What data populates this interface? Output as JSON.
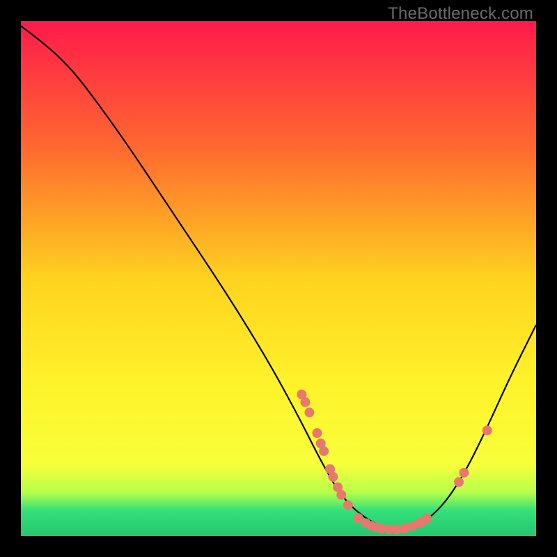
{
  "watermark": "TheBottleneck.com",
  "chart_data": {
    "type": "line",
    "title": "",
    "xlabel": "",
    "ylabel": "",
    "xlim": [
      0,
      100
    ],
    "ylim": [
      0,
      100
    ],
    "background_gradient": {
      "stops": [
        {
          "offset": 0.0,
          "color": "#ff1a4b"
        },
        {
          "offset": 0.25,
          "color": "#ff6a2f"
        },
        {
          "offset": 0.5,
          "color": "#ffd21f"
        },
        {
          "offset": 0.7,
          "color": "#fff22a"
        },
        {
          "offset": 0.86,
          "color": "#f7ff3a"
        },
        {
          "offset": 0.915,
          "color": "#b6ff4a"
        },
        {
          "offset": 0.95,
          "color": "#35e07a"
        },
        {
          "offset": 1.0,
          "color": "#24c76f"
        }
      ]
    },
    "curve": [
      {
        "x": 0,
        "y": 99
      },
      {
        "x": 4,
        "y": 96
      },
      {
        "x": 8,
        "y": 92.5
      },
      {
        "x": 12,
        "y": 88
      },
      {
        "x": 20,
        "y": 77
      },
      {
        "x": 30,
        "y": 62
      },
      {
        "x": 40,
        "y": 47
      },
      {
        "x": 48,
        "y": 34
      },
      {
        "x": 54,
        "y": 23
      },
      {
        "x": 58,
        "y": 15
      },
      {
        "x": 62,
        "y": 8
      },
      {
        "x": 66,
        "y": 4
      },
      {
        "x": 70,
        "y": 1.8
      },
      {
        "x": 74,
        "y": 1.2
      },
      {
        "x": 78,
        "y": 2.5
      },
      {
        "x": 82,
        "y": 6
      },
      {
        "x": 86,
        "y": 12
      },
      {
        "x": 90,
        "y": 20
      },
      {
        "x": 95,
        "y": 31
      },
      {
        "x": 100,
        "y": 41
      }
    ],
    "markers": [
      {
        "x": 54.5,
        "y": 27.5
      },
      {
        "x": 55.2,
        "y": 26.0
      },
      {
        "x": 56.0,
        "y": 24.0
      },
      {
        "x": 57.5,
        "y": 20.0
      },
      {
        "x": 58.2,
        "y": 18.0
      },
      {
        "x": 58.8,
        "y": 16.5
      },
      {
        "x": 60.0,
        "y": 13.0
      },
      {
        "x": 60.6,
        "y": 11.5
      },
      {
        "x": 61.5,
        "y": 9.5
      },
      {
        "x": 62.2,
        "y": 8.0
      },
      {
        "x": 63.5,
        "y": 6.0
      },
      {
        "x": 65.5,
        "y": 3.5
      },
      {
        "x": 67.0,
        "y": 2.5
      },
      {
        "x": 68.0,
        "y": 2.0
      },
      {
        "x": 69.0,
        "y": 1.7
      },
      {
        "x": 70.0,
        "y": 1.5
      },
      {
        "x": 71.5,
        "y": 1.3
      },
      {
        "x": 73.0,
        "y": 1.3
      },
      {
        "x": 74.5,
        "y": 1.5
      },
      {
        "x": 76.0,
        "y": 2.0
      },
      {
        "x": 77.5,
        "y": 2.6
      },
      {
        "x": 78.8,
        "y": 3.4
      },
      {
        "x": 85.0,
        "y": 10.5
      },
      {
        "x": 86.0,
        "y": 12.3
      },
      {
        "x": 90.5,
        "y": 20.5
      }
    ],
    "marker_color": "#e8786e",
    "curve_color": "#000000"
  }
}
